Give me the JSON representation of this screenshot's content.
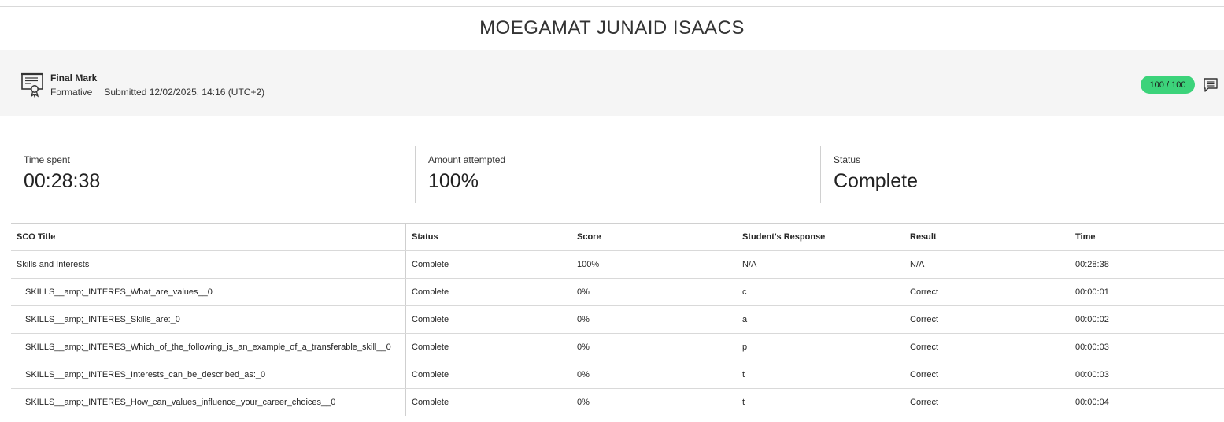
{
  "student": {
    "name": "MOEGAMAT JUNAID ISAACS"
  },
  "grade": {
    "title": "Final Mark",
    "type": "Formative",
    "submitted": "Submitted 12/02/2025, 14:16 (UTC+2)",
    "score": "100 / 100",
    "score_color": "#3cd37a",
    "icon": "certificate-icon",
    "feedback_icon": "comment-icon"
  },
  "stats": {
    "time_spent": {
      "label": "Time spent",
      "value": "00:28:38"
    },
    "amount_attempted": {
      "label": "Amount attempted",
      "value": "100%"
    },
    "status": {
      "label": "Status",
      "value": "Complete"
    }
  },
  "table": {
    "headers": {
      "title": "SCO Title",
      "status": "Status",
      "score": "Score",
      "response": "Student's Response",
      "result": "Result",
      "time": "Time"
    },
    "rows": [
      {
        "title": "Skills and Interests",
        "status": "Complete",
        "score": "100%",
        "response": "N/A",
        "result": "N/A",
        "time": "00:28:38"
      },
      {
        "title": "SKILLS__amp;_INTERES_What_are_values__0",
        "status": "Complete",
        "score": "0%",
        "response": "c",
        "result": "Correct",
        "time": "00:00:01"
      },
      {
        "title": "SKILLS__amp;_INTERES_Skills_are:_0",
        "status": "Complete",
        "score": "0%",
        "response": "a",
        "result": "Correct",
        "time": "00:00:02"
      },
      {
        "title": "SKILLS__amp;_INTERES_Which_of_the_following_is_an_example_of_a_transferable_skill__0",
        "status": "Complete",
        "score": "0%",
        "response": "p",
        "result": "Correct",
        "time": "00:00:03"
      },
      {
        "title": "SKILLS__amp;_INTERES_Interests_can_be_described_as:_0",
        "status": "Complete",
        "score": "0%",
        "response": "t",
        "result": "Correct",
        "time": "00:00:03"
      },
      {
        "title": "SKILLS__amp;_INTERES_How_can_values_influence_your_career_choices__0",
        "status": "Complete",
        "score": "0%",
        "response": "t",
        "result": "Correct",
        "time": "00:00:04"
      }
    ]
  }
}
